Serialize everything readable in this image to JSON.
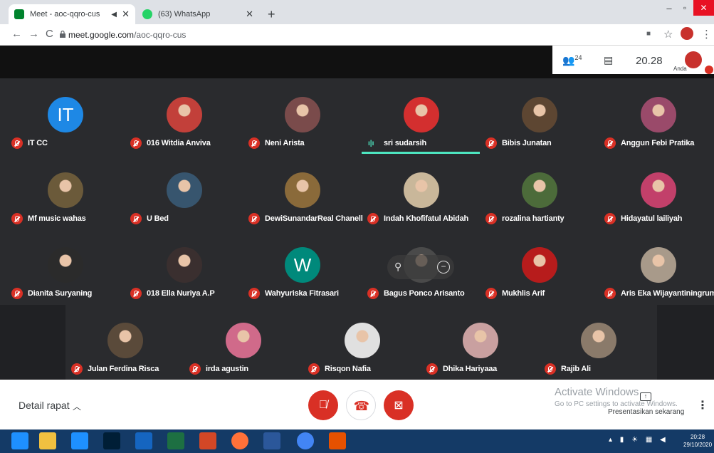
{
  "browser": {
    "tabs": [
      {
        "label": "Meet - aoc-qqro-cus",
        "active": true
      },
      {
        "label": "(63) WhatsApp",
        "active": false
      }
    ],
    "new_tab": "+",
    "url_host": "meet.google.com",
    "url_path": "/aoc-qqro-cus",
    "window_controls": {
      "minimize": "–",
      "maximize": "▫",
      "close": "✕"
    }
  },
  "meet": {
    "participants_count": "24",
    "time": "20.28",
    "self_label": "Anda",
    "participants": [
      {
        "name": "IT CC",
        "initial": "IT",
        "avatar_color": "#1e88e5"
      },
      {
        "name": "016 Witdia Anviva",
        "avatar_color": "#c2403a"
      },
      {
        "name": "Neni Arista",
        "avatar_color": "#7a4b4b"
      },
      {
        "name": "sri sudarsih",
        "avatar_color": "#d32f2f",
        "speaking": true
      },
      {
        "name": "Bibis Junatan",
        "avatar_color": "#5d4632"
      },
      {
        "name": "Anggun Febi Pratika",
        "avatar_color": "#9a4a6a"
      },
      {
        "name": "Mf music wahas",
        "avatar_color": "#6b5a3a"
      },
      {
        "name": "U Bed",
        "avatar_color": "#37556e"
      },
      {
        "name": "DewiSunandarReal Chanell",
        "avatar_color": "#8a6a3a"
      },
      {
        "name": "Indah Khofifatul Abidah",
        "avatar_color": "#c9b79a"
      },
      {
        "name": "rozalina hartianty",
        "avatar_color": "#4c6b3a"
      },
      {
        "name": "Hidayatul lailiyah",
        "avatar_color": "#c2406a"
      },
      {
        "name": "Dianita Suryaning",
        "avatar_color": "#2b2b2b"
      },
      {
        "name": "018 Ella Nuriya A.P",
        "avatar_color": "#3a2f2f"
      },
      {
        "name": "Wahyuriska Fitrasari",
        "initial": "W",
        "avatar_color": "#00897b"
      },
      {
        "name": "Bagus Ponco Arisanto",
        "avatar_color": "#4a4a4a"
      },
      {
        "name": "Mukhlis Arif",
        "avatar_color": "#b71c1c"
      },
      {
        "name": "Aris Eka Wijayantiningrum",
        "avatar_color": "#a89a8a"
      },
      {
        "name": "Julan Ferdina Risca",
        "avatar_color": "#5a4a3a"
      },
      {
        "name": "irda agustin",
        "avatar_color": "#d06a8a"
      },
      {
        "name": "Risqon Nafia",
        "avatar_color": "#e0e0e0"
      },
      {
        "name": "Dhika Hariyaaa",
        "avatar_color": "#c9a0a0"
      },
      {
        "name": "Rajib Ali",
        "avatar_color": "#8a7a6a"
      }
    ],
    "detail_label": "Detail rapat",
    "activate_title": "Activate Windows",
    "activate_sub": "Go to PC settings to activate Windows.",
    "present_label": "Presentasikan sekarang"
  },
  "taskbar": {
    "time": "20:28",
    "date": "29/10/2020",
    "apps": [
      "windows-start",
      "file-explorer",
      "internet-explorer",
      "photoshop",
      "defender",
      "excel",
      "powerpoint",
      "firefox",
      "word",
      "chrome",
      "foxit"
    ]
  },
  "colors": {
    "mute_red": "#d93025",
    "speaking_teal": "#4de6c0",
    "taskbar": "#143a66"
  }
}
